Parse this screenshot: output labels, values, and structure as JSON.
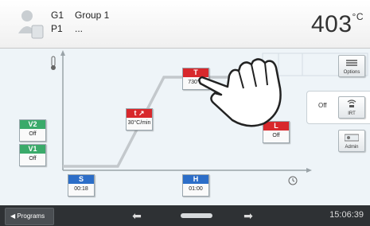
{
  "header": {
    "group_id": "G1",
    "group_name": "Group 1",
    "program_id": "P1",
    "program_name": "...",
    "temperature": "403",
    "temperature_unit": "°C"
  },
  "graph": {
    "v2": {
      "label": "V2",
      "value": "Off"
    },
    "v1": {
      "label": "V1",
      "value": "Off"
    },
    "s": {
      "label": "S",
      "value": "00:18"
    },
    "t_rate": {
      "label": "t ↗",
      "value": "30°C/min"
    },
    "t_hold": {
      "label": "T",
      "value": "730°C"
    },
    "l": {
      "label": "L",
      "value": "Off"
    },
    "h": {
      "label": "H",
      "value": "01:00"
    }
  },
  "side": {
    "options_label": "Options",
    "irt_state": "Off",
    "irt_label": "IRT",
    "admin_label": "Admin"
  },
  "bottom": {
    "programs_label": "Programs",
    "time": "15:06:39"
  },
  "colors": {
    "green": "#3aaa6a",
    "blue": "#2c6ec8",
    "red": "#d8282c",
    "bar": "#2e3134"
  }
}
